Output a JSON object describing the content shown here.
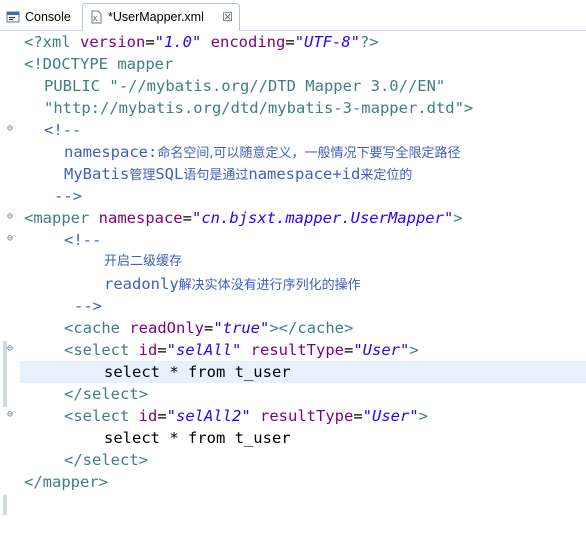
{
  "tabs": [
    {
      "label": "Console",
      "icon": "console-icon"
    },
    {
      "label": "*UserMapper.xml",
      "icon": "xml-file-icon",
      "close": "☒"
    }
  ],
  "code": {
    "l1": {
      "a": "<?xml ",
      "b": "version",
      "c": "=",
      "d": "\"1.0\"",
      "e": " encoding",
      "f": "=",
      "g": "\"UTF-8\"",
      "h": "?>"
    },
    "l2": "<!DOCTYPE mapper",
    "l3": "PUBLIC \"-//mybatis.org//DTD Mapper 3.0//EN\"",
    "l4": "\"http://mybatis.org/dtd/mybatis-3-mapper.dtd\">",
    "l5": "<!--",
    "l6": {
      "a": "namespace:",
      "b": "命名空间,可以随意定义，一般情况下要写全限定路径"
    },
    "l7": {
      "a": "MyBatis",
      "b": "管理",
      "c": "SQL",
      "d": "语句是通过",
      "e": "namespace+id",
      "f": "来定位的"
    },
    "l8": "-->",
    "l9": {
      "a": "<mapper ",
      "b": "namespace",
      "c": "=",
      "d": "\"cn.bjsxt.mapper.UserMapper\"",
      "e": ">"
    },
    "l10": "<!--",
    "l11": "开启二级缓存",
    "l12": {
      "a": "readonly",
      "b": "解决实体没有进行序列化的操作"
    },
    "l13": "-->",
    "l14": {
      "a": "<cache ",
      "b": "readOnly",
      "c": "=",
      "d": "\"true\"",
      "e": "></cache>"
    },
    "l15": {
      "a": "<select ",
      "b": "id",
      "c": "=",
      "d": "\"selAll\"",
      "e": " resultType",
      "f": "=",
      "g": "\"User\"",
      "h": ">"
    },
    "l16": "select * from t_user",
    "l17": "</select>",
    "l18": {
      "a": "<select ",
      "b": "id",
      "c": "=",
      "d": "\"selAll2\"",
      "e": " resultType",
      "f": "=",
      "g": "\"User\"",
      "h": ">"
    },
    "l19": "select * from t_user",
    "l20": "</select>",
    "l21": "</mapper>"
  },
  "fold_glyph": "⊖",
  "colors": {
    "tag": "#3f7f7f",
    "attr": "#7f007f",
    "value": "#2a00ff",
    "comment": "#3f5fbf",
    "current_line": "#e8f2fe"
  }
}
